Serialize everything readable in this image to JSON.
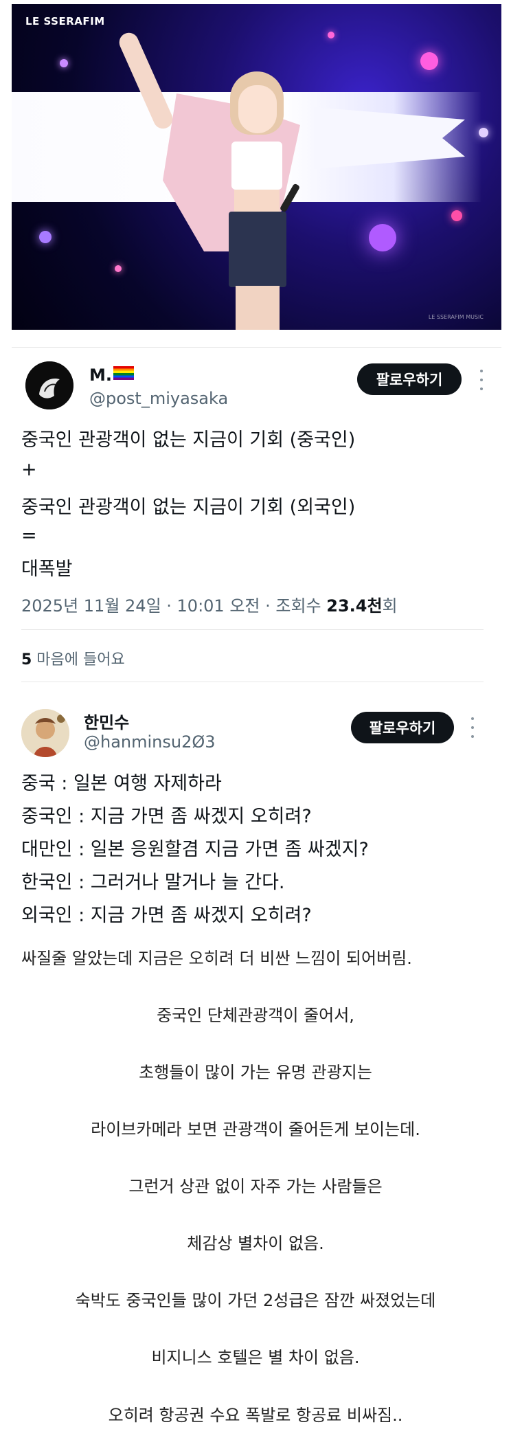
{
  "photo": {
    "logo_text": "LE SSERAFIM",
    "watermark": "LE SSERAFIM MUSIC"
  },
  "tweet1": {
    "display_name": "M.",
    "flag_icon": "rainbow-flag-icon",
    "handle": "@post_miyasaka",
    "follow_label": "팔로우하기",
    "lines": [
      " 중국인 관광객이 없는 지금이 기회 (중국인)",
      "+",
      "중국인 관광객이 없는 지금이 기회 (외국인)",
      "=",
      "대폭발"
    ],
    "meta_prefix": "2025년 11월 24일 · 10:01 오전 · 조회수 ",
    "views": "23.4천",
    "views_suffix": "회",
    "likes_count": "5",
    "likes_label": " 마음에 들어요"
  },
  "tweet2": {
    "display_name": "한민수",
    "handle": "@hanminsu2Ø3",
    "follow_label": "팔로우하기",
    "lines": [
      "중국 : 일본 여행 자제하라",
      "중국인 : 지금 가면 좀 싸겠지 오히려?",
      "대만인 : 일본 응원할겸 지금 가면 좀 싸겠지?",
      "한국인 : 그러거나 말거나 늘 간다.",
      "외국인 : 지금 가면 좀 싸겠지 오히려?"
    ]
  },
  "post": {
    "first_line": "싸질줄 알았는데 지금은 오히려 더 비싼 느낌이 되어버림.",
    "centered_lines": [
      "중국인 단체관광객이 줄어서,",
      "초행들이 많이 가는 유명 관광지는",
      "라이브카메라 보면  관광객이 줄어든게 보이는데.",
      "그런거 상관 없이 자주 가는 사람들은",
      "체감상 별차이 없음.",
      "숙박도 중국인들 많이 가던 2성급은 잠깐 싸졌었는데",
      "비지니스 호텔은 별 차이 없음.",
      "오히려 항공권 수요 폭발로 항공료 비싸짐.."
    ]
  }
}
